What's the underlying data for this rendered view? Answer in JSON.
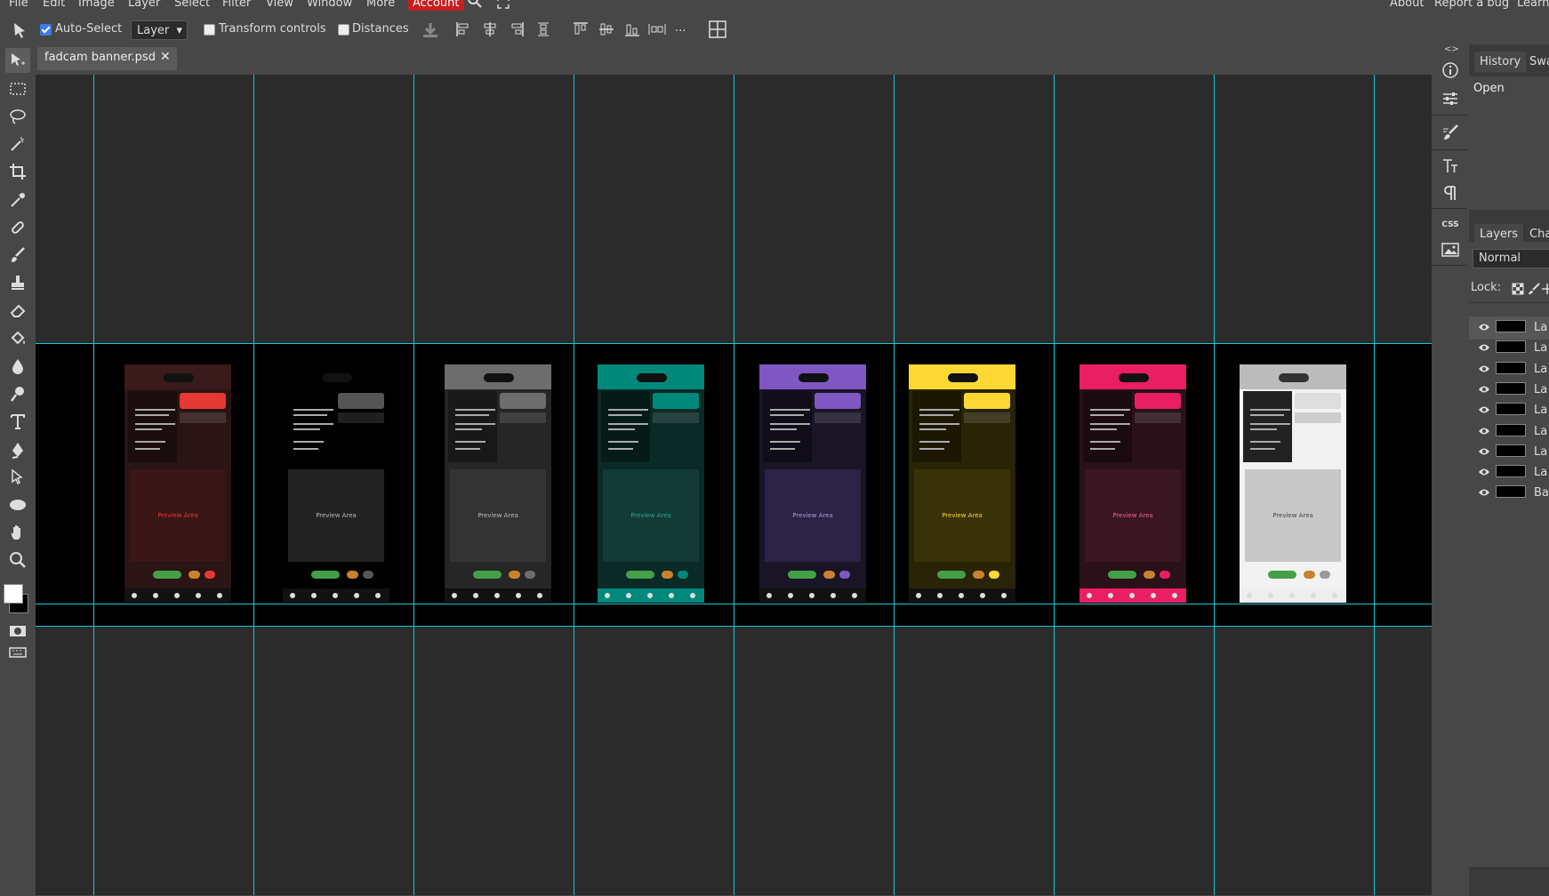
{
  "menubar": {
    "items": [
      "File",
      "Edit",
      "Image",
      "Layer",
      "Select",
      "Filter",
      "View",
      "Window",
      "More"
    ],
    "account": "Account",
    "right_items": [
      "About",
      "Report a bug",
      "Learn"
    ]
  },
  "options": {
    "auto_select": {
      "label": "Auto-Select",
      "checked": true
    },
    "layer_select": "Layer",
    "transform_controls": {
      "label": "Transform controls",
      "checked": false
    },
    "distances": {
      "label": "Distances",
      "checked": false
    },
    "more": "..."
  },
  "document": {
    "tab_name": "fadcam banner.psd",
    "close": "✕"
  },
  "phones": [
    {
      "accent": "#e53935",
      "bg": "#2a1414",
      "preview_bg": "#3a1616",
      "preview_text": "#e53935"
    },
    {
      "accent": "#555555",
      "bg": "#000000",
      "preview_bg": "#222222",
      "preview_text": "#bbbbbb"
    },
    {
      "accent": "#6d6d6d",
      "bg": "#262626",
      "preview_bg": "#333333",
      "preview_text": "#bbbbbb"
    },
    {
      "accent": "#00897b",
      "bg": "#0a2a26",
      "preview_bg": "#133a35",
      "preview_text": "#26a69a"
    },
    {
      "accent": "#7e57c2",
      "bg": "#1a1526",
      "preview_bg": "#2c2246",
      "preview_text": "#b39ddb"
    },
    {
      "accent": "#fdd835",
      "bg": "#2a2406",
      "preview_bg": "#3a3208",
      "preview_text": "#fdd835"
    },
    {
      "accent": "#e91e63",
      "bg": "#2a1018",
      "preview_bg": "#3a1622",
      "preview_text": "#f06292"
    },
    {
      "accent": "#bbbbbb",
      "bg": "#f2f2f2",
      "preview_bg": "#c8c8c8",
      "preview_text": "#444444"
    }
  ],
  "preview_label": "Preview Area",
  "panels": {
    "tabs_top": [
      "History",
      "Swa"
    ],
    "history_items": [
      "Open"
    ],
    "tabs_layers": [
      "Layers",
      "Cha"
    ],
    "blend_mode": "Normal",
    "lock_label": "Lock:",
    "layers": [
      "La",
      "La",
      "La",
      "La",
      "La",
      "La",
      "La",
      "La",
      "Ba"
    ]
  },
  "colors": {
    "guide": "#1ac6d6",
    "account_bg": "#c81e1e",
    "ui_gray": "#474747",
    "workspace": "#2b2b2b"
  },
  "icons": {
    "toolbar": [
      "move-tool-icon",
      "marquee-tool-icon",
      "lasso-tool-icon",
      "magic-wand-tool-icon",
      "crop-tool-icon",
      "eyedropper-tool-icon",
      "healing-tool-icon",
      "brush-tool-icon",
      "clone-stamp-tool-icon",
      "eraser-tool-icon",
      "paint-bucket-tool-icon",
      "blur-tool-icon",
      "dodge-tool-icon",
      "type-tool-icon",
      "pen-tool-icon",
      "path-select-tool-icon",
      "shape-tool-icon",
      "hand-tool-icon",
      "zoom-tool-icon"
    ]
  }
}
